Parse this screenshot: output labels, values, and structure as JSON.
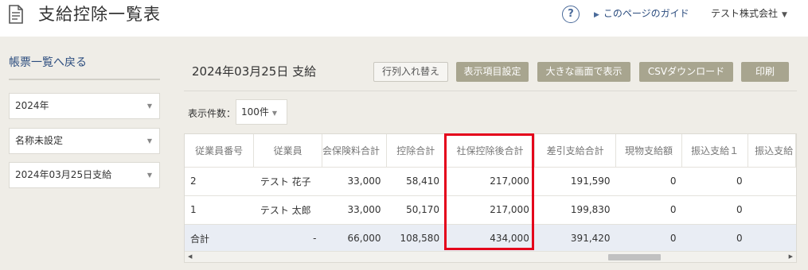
{
  "header": {
    "title": "支給控除一覧表",
    "help_icon_text": "?",
    "guide_link": "このページのガイド",
    "company": "テスト株式会社"
  },
  "sidebar": {
    "back_link": "帳票一覧へ戻る",
    "year_select": "2024年",
    "name_select": "名称未設定",
    "payment_select": "2024年03月25日支給"
  },
  "main": {
    "date_title": "2024年03月25日 支給",
    "buttons": {
      "swap": "行列入れ替え",
      "columns": "表示項目設定",
      "large": "大きな画面で表示",
      "csv": "CSVダウンロード",
      "print": "印刷"
    },
    "count_label": "表示件数：",
    "count_value": "100件"
  },
  "table": {
    "headers": [
      "従業員番号",
      "従業員",
      "社会保険料合計",
      "控除合計",
      "社保控除後合計",
      "差引支給合計",
      "現物支給額",
      "振込支給１",
      "振込支給"
    ],
    "header_visible": [
      "従業員番号",
      "従業員",
      "会保険料合計",
      "控除合計",
      "社保控除後合計",
      "差引支給合計",
      "現物支給額",
      "振込支給１",
      "振込支給"
    ],
    "rows": [
      [
        "2",
        "テスト 花子",
        "33,000",
        "58,410",
        "217,000",
        "191,590",
        "0",
        "0",
        ""
      ],
      [
        "1",
        "テスト 太郎",
        "33,000",
        "50,170",
        "217,000",
        "199,830",
        "0",
        "0",
        ""
      ]
    ],
    "total": [
      "合計",
      "-",
      "66,000",
      "108,580",
      "434,000",
      "391,420",
      "0",
      "0",
      ""
    ]
  },
  "colors": {
    "highlight": "#e4001b",
    "solid_button": "#a8a58f",
    "link": "#2b4c7e",
    "total_row": "#e9edf4"
  },
  "icons": [
    "document-icon",
    "help-icon",
    "triangle-right-icon",
    "caret-down-icon"
  ]
}
